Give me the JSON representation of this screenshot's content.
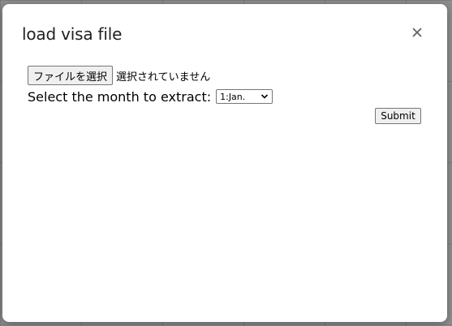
{
  "dialog": {
    "title": "load visa file",
    "close_icon": "close-icon"
  },
  "file_input": {
    "button_label": "ファイルを選択",
    "status_text": "選択されていません"
  },
  "month": {
    "label": "Select the month to extract:",
    "selected": "1:Jan.",
    "chevron_icon": "chevron-down-icon"
  },
  "submit": {
    "label": "Submit"
  }
}
